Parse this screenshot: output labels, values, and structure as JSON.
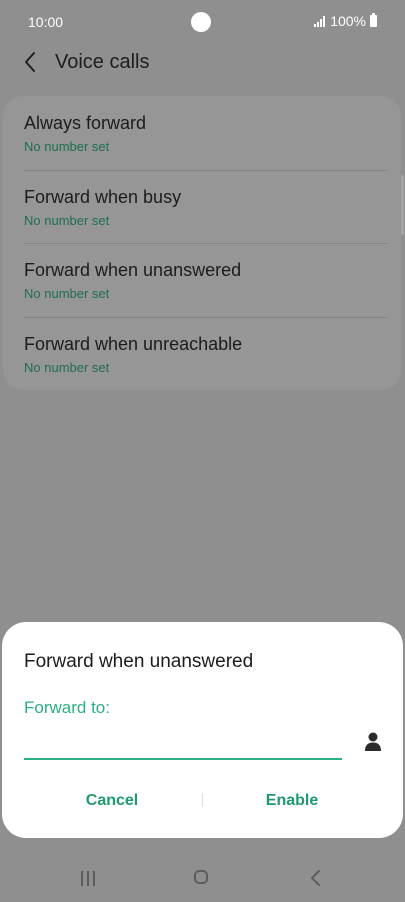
{
  "status_bar": {
    "time": "10:00",
    "battery": "100%"
  },
  "header": {
    "title": "Voice calls"
  },
  "forwarding_options": [
    {
      "title": "Always forward",
      "subtitle": "No number set"
    },
    {
      "title": "Forward when busy",
      "subtitle": "No number set"
    },
    {
      "title": "Forward when unanswered",
      "subtitle": "No number set"
    },
    {
      "title": "Forward when unreachable",
      "subtitle": "No number set"
    }
  ],
  "dialog": {
    "title": "Forward when unanswered",
    "field_label": "Forward to:",
    "field_value": "",
    "cancel_label": "Cancel",
    "enable_label": "Enable"
  },
  "colors": {
    "accent": "#2bb17f",
    "dim_overlay": "#8f8f8f"
  },
  "icons": {
    "back": "back-chevron-icon",
    "contact": "contact-person-icon",
    "signal": "signal-icon",
    "battery": "battery-icon"
  }
}
